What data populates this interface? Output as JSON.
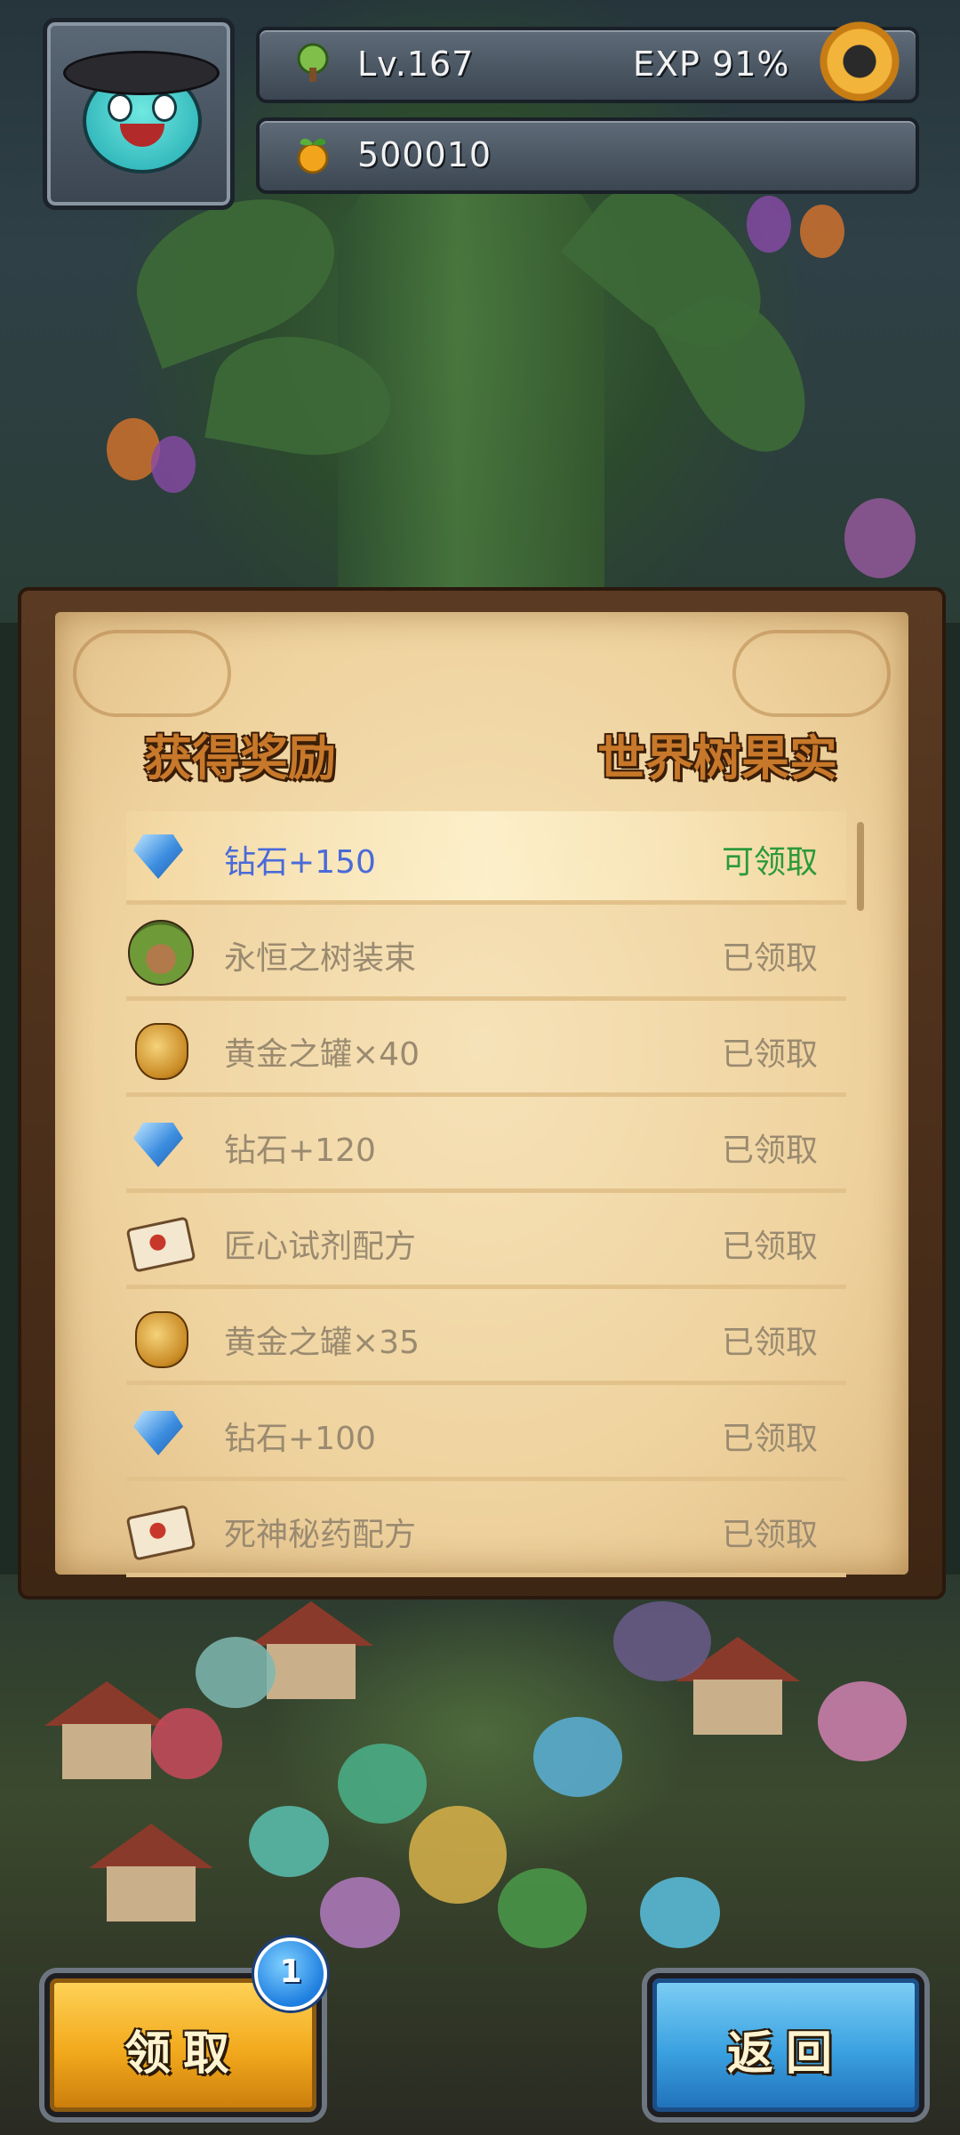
{
  "header": {
    "level": "Lv.167",
    "exp": "EXP 91%",
    "coins": "500010"
  },
  "panel": {
    "title_left": "获得奖励",
    "title_right": "世界树果实",
    "rewards": [
      {
        "label": "钻石+150",
        "status": "可领取",
        "icon": "diamond-icon"
      },
      {
        "label": "永恒之树装束",
        "status": "已领取",
        "icon": "tree-costume-icon"
      },
      {
        "label": "黄金之罐×40",
        "status": "已领取",
        "icon": "golden-jar-icon"
      },
      {
        "label": "钻石+120",
        "status": "已领取",
        "icon": "diamond-icon"
      },
      {
        "label": "匠心试剂配方",
        "status": "已领取",
        "icon": "recipe-scroll-icon"
      },
      {
        "label": "黄金之罐×35",
        "status": "已领取",
        "icon": "golden-jar-icon"
      },
      {
        "label": "钻石+100",
        "status": "已领取",
        "icon": "diamond-icon"
      },
      {
        "label": "死神秘药配方",
        "status": "已领取",
        "icon": "recipe-scroll-icon"
      }
    ]
  },
  "buttons": {
    "claim": "领取",
    "claim_badge": "1",
    "back": "返回"
  },
  "colors": {
    "claimable": "#2c9a3a",
    "claimed": "#9a8a70",
    "highlight_label": "#4a6ad8"
  }
}
